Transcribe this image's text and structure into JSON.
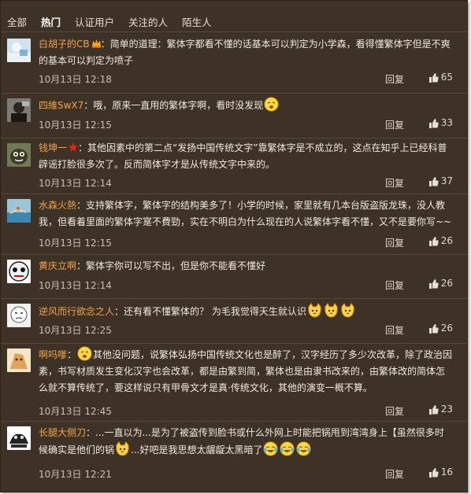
{
  "tabs": [
    "全部",
    "热门",
    "认证用户",
    "关注的人",
    "陌生人"
  ],
  "active_tab": "热门",
  "reply_label": "回复",
  "colors": {
    "background": "#3e3227",
    "username": "#f0a34a",
    "text": "#f1e9de",
    "meta": "#cbbfb0"
  },
  "comments": [
    {
      "user": "白胡子的CB",
      "text": "：简单的道理：繁体字都看不懂的话基本可以判定为小学森，看得懂繁体字但是不爽的基本可以判定为喷子",
      "time": "10月13日 12:18",
      "likes": "65",
      "badge": "vip-crown-icon"
    },
    {
      "user": "四維SwX7",
      "text": "：哦，原来一直用的繁体字啊，看时没发现",
      "time": "10月13日 12:15",
      "likes": "33"
    },
    {
      "user": "钱坤一",
      "text": "：其他因素中的第二点“发扬中国传统文字”靠繁体字是不成立的，这点在知乎上已经科普辟谣打脸很多次了。反而简体字才是从传统文字中来的。",
      "time": "10月13日 12:14",
      "likes": "37",
      "badge": "star-icon"
    },
    {
      "user": "水森火熱",
      "text": "：支持繁体字，繁体字的结构美多了！小学的时候，家里就有几本台版盗版龙珠，没人教我，但看着里面的繁体字寔不費勁，实在不明白为什么现在的人说繁体字看不懂，又不是要你写~~",
      "time": "10月13日 12:15",
      "likes": "26"
    },
    {
      "user": "黄庆立啊",
      "text": "：繁体字你可以写不出，但是你不能看不懂好",
      "time": "10月13日 12:14",
      "likes": "26"
    },
    {
      "user": "逆风而行欲念之人",
      "text": "：还有看不懂繁体的？ 为毛我觉得天生就认识",
      "time": "10月13日 12:25",
      "likes": "26"
    },
    {
      "user": "啊吗嗲",
      "text_a": "：",
      "text_b": "其他没问题，说繁体弘扬中国传统文化也是醉了，汉字经历了多少次改革，除了政治因素，书写材质发生变化汉字也会改革，都是由繁到简，繁体也是由隶书改来的，由繁体改的简体怎么就不算传统了，要这样说只有甲骨文才是真·传统文化，其他的演变一概不算。",
      "time": "10月13日 12:45",
      "likes": "23"
    },
    {
      "user": "长腿大侧刀",
      "text_a": "：...一直以为...是为了被盗传到脸书或什么外网上时能把锅甩到湾湾身上【虽然很多时候确实是他们的锅",
      "text_b": "...好吧是我思想太龌龊太黑暗了",
      "time": "10月13日 12:21",
      "likes": "16"
    }
  ]
}
